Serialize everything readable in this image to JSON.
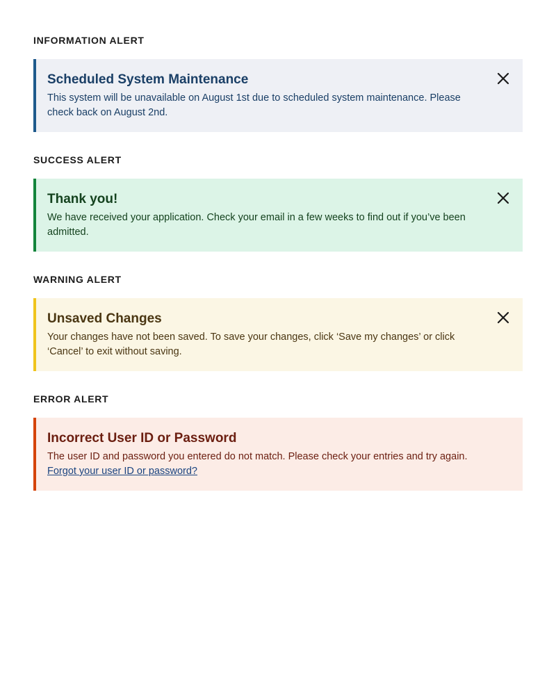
{
  "colors": {
    "info_accent": "#1e5a8c",
    "info_background": "#eef0f5",
    "success_accent": "#13843b",
    "success_background": "#dcf4e7",
    "warning_accent": "#f0c41c",
    "warning_background": "#fbf6e4",
    "error_accent": "#d54309",
    "error_background": "#fcece6",
    "link": "#1a4480"
  },
  "alerts": [
    {
      "section_label": "INFORMATION ALERT",
      "title": "Scheduled System Maintenance",
      "body": "This system will be unavailable on August 1st due to scheduled system maintenance. Please check back on August 2nd.",
      "dismissible": true,
      "close_icon": "close-icon"
    },
    {
      "section_label": "SUCCESS ALERT",
      "title": "Thank you!",
      "body": "We have received your application. Check your email in a few weeks to find out if you’ve been admitted.",
      "dismissible": true,
      "close_icon": "close-icon"
    },
    {
      "section_label": "WARNING ALERT",
      "title": "Unsaved Changes",
      "body": "Your changes have not been saved. To save your changes, click ‘Save my changes’ or click ‘Cancel’ to exit without saving.",
      "dismissible": true,
      "close_icon": "close-icon"
    },
    {
      "section_label": "ERROR ALERT",
      "title": "Incorrect User ID or Password",
      "body": "The user ID and password you entered do not match. Please check your entries and try again.",
      "link_text": "Forgot your user ID or password?",
      "dismissible": false
    }
  ]
}
